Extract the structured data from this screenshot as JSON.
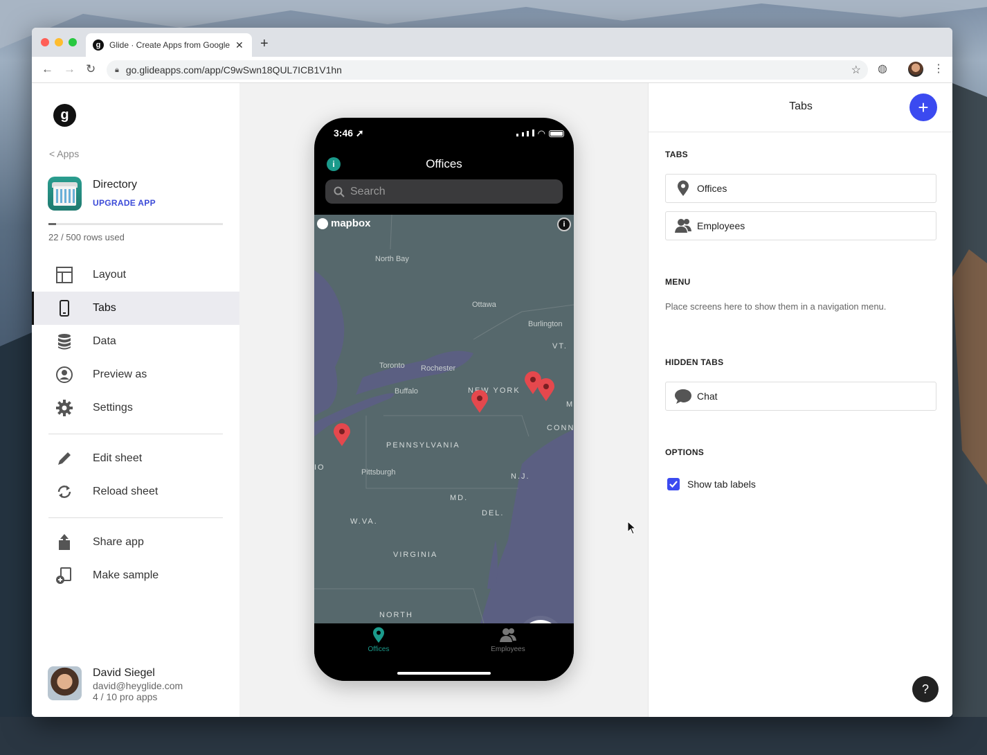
{
  "browser": {
    "tab_title": "Glide · Create Apps from Google Sheets",
    "url": "go.glideapps.com/app/C9wSwn18QUL7ICB1V1hn",
    "favicon_letter": "g"
  },
  "sidebar": {
    "logo_letter": "g",
    "back_label": "Apps",
    "app_name": "Directory",
    "upgrade_label": "UPGRADE APP",
    "rows_used_text": "22 / 500 rows used",
    "rows_used_fraction": 0.044,
    "nav": [
      {
        "label": "Layout",
        "icon": "layout-icon"
      },
      {
        "label": "Tabs",
        "icon": "phone-icon",
        "active": true
      },
      {
        "label": "Data",
        "icon": "database-icon"
      },
      {
        "label": "Preview as",
        "icon": "user-circle-icon"
      },
      {
        "label": "Settings",
        "icon": "gear-icon"
      }
    ],
    "sheet_actions": [
      {
        "label": "Edit sheet",
        "icon": "pencil-icon"
      },
      {
        "label": "Reload sheet",
        "icon": "reload-icon"
      }
    ],
    "app_actions": [
      {
        "label": "Share app",
        "icon": "share-icon"
      },
      {
        "label": "Make sample",
        "icon": "copy-icon"
      }
    ],
    "user": {
      "name": "David Siegel",
      "email": "david@heyglide.com",
      "apps": "4 / 10 pro apps"
    }
  },
  "phone": {
    "time": "3:46",
    "title": "Offices",
    "search_placeholder": "Search",
    "map_brand": "mapbox",
    "map_labels": {
      "north_bay": "North Bay",
      "ottawa": "Ottawa",
      "burlington": "Burlington",
      "vt": "VT.",
      "toronto": "Toronto",
      "rochester": "Rochester",
      "buffalo": "Buffalo",
      "new_york": "NEW YORK",
      "ma": "MA",
      "conn": "CONN.",
      "pennsylvania": "PENNSYLVANIA",
      "ohio": "IO",
      "pittsburgh": "Pittsburgh",
      "nj": "N.J.",
      "md": "MD.",
      "del": "DEL.",
      "wva": "W.VA.",
      "virginia": "VIRGINIA",
      "north_carolina": "NORTH"
    },
    "tabs": [
      {
        "label": "Offices",
        "icon": "pin-icon",
        "active": true
      },
      {
        "label": "Employees",
        "icon": "people-icon"
      }
    ]
  },
  "panel": {
    "title": "Tabs",
    "tabs_section": "TABS",
    "tabs": [
      {
        "label": "Offices",
        "icon": "pin-icon"
      },
      {
        "label": "Employees",
        "icon": "people-icon"
      }
    ],
    "menu_section": "MENU",
    "menu_desc": "Place screens here to show them in a navigation menu.",
    "hidden_section": "HIDDEN TABS",
    "hidden_tabs": [
      {
        "label": "Chat",
        "icon": "chat-icon"
      }
    ],
    "options_section": "OPTIONS",
    "show_labels": "Show tab labels",
    "show_labels_checked": true,
    "help_label": "?"
  },
  "colors": {
    "accent": "#3b4af0",
    "teal": "#1b9a8b",
    "pin": "#e5484d"
  }
}
